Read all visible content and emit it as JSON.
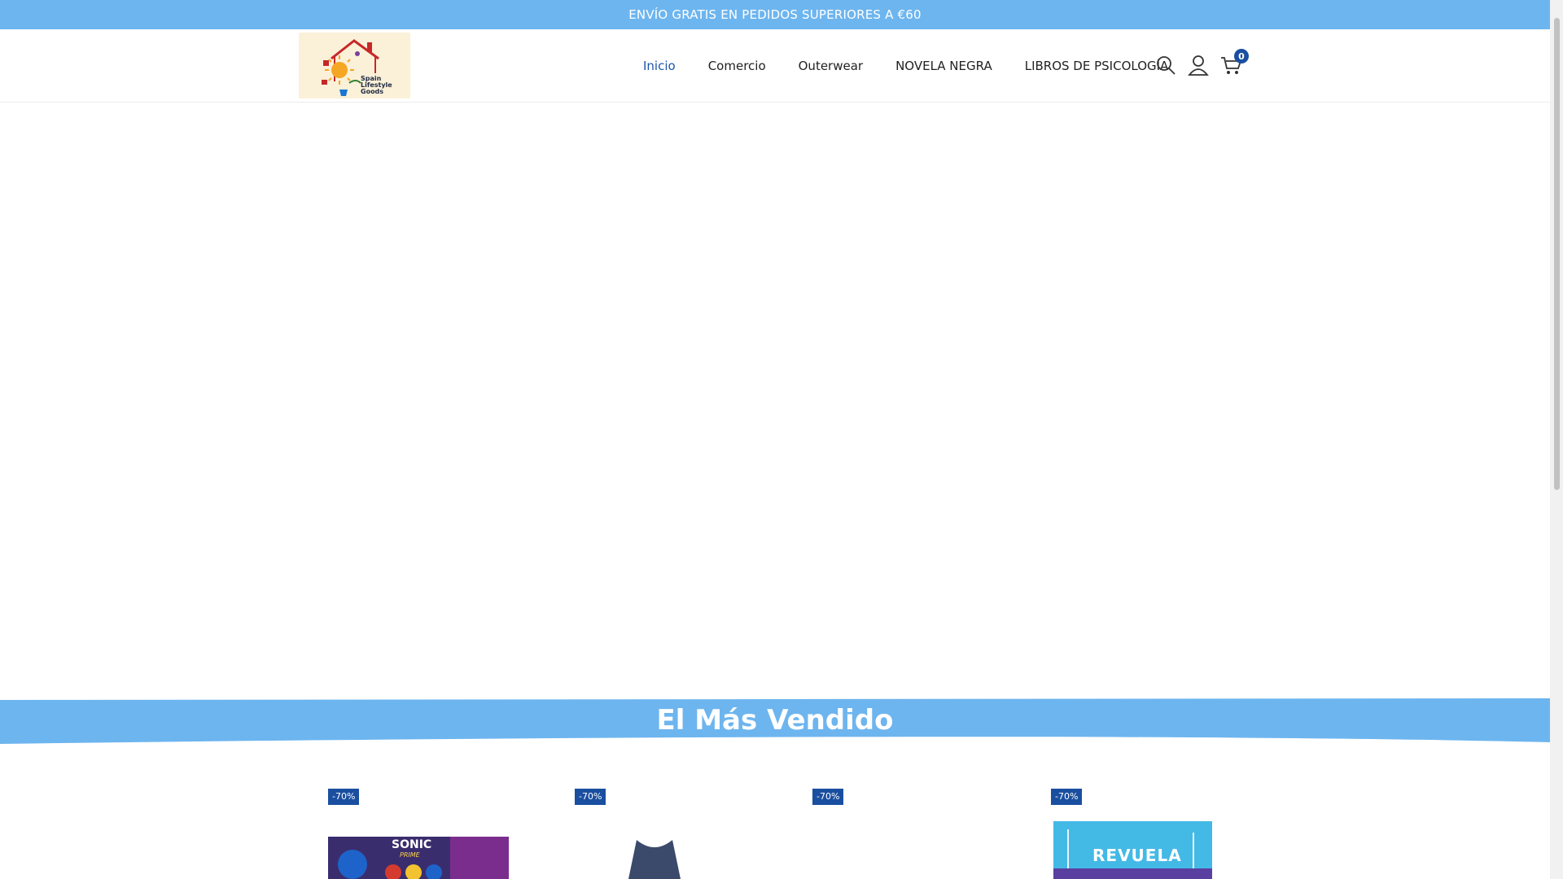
{
  "announcement": "ENVÍO GRATIS EN PEDIDOS SUPERIORES A €60",
  "logo": {
    "line1": "Spain",
    "line2": "Lifestyle",
    "line3": "Goods"
  },
  "nav": [
    {
      "label": "Inicio",
      "active": true
    },
    {
      "label": "Comercio",
      "active": false
    },
    {
      "label": "Outerwear",
      "active": false
    },
    {
      "label": "NOVELA NEGRA",
      "active": false
    },
    {
      "label": "LIBROS DE PSICOLOGÍA",
      "active": false
    }
  ],
  "header_icons": [
    "search-icon",
    "user-icon",
    "cart-icon"
  ],
  "cart_count": "0",
  "section_title": "El Más Vendido",
  "products": [
    {
      "discount": "-70%",
      "image_text": "SONIC",
      "image_subtext": "PRIME"
    },
    {
      "discount": "-70%",
      "image_text": "",
      "image_subtext": ""
    },
    {
      "discount": "-70%",
      "image_text": "",
      "image_subtext": ""
    },
    {
      "discount": "-70%",
      "image_text": "REVUELA",
      "image_subtext": ""
    }
  ],
  "colors": {
    "announcement_bg": "#6db5ef",
    "accent": "#1a4fa0",
    "nav_active": "#1e56a8",
    "banner_bg": "#6db5ef"
  }
}
